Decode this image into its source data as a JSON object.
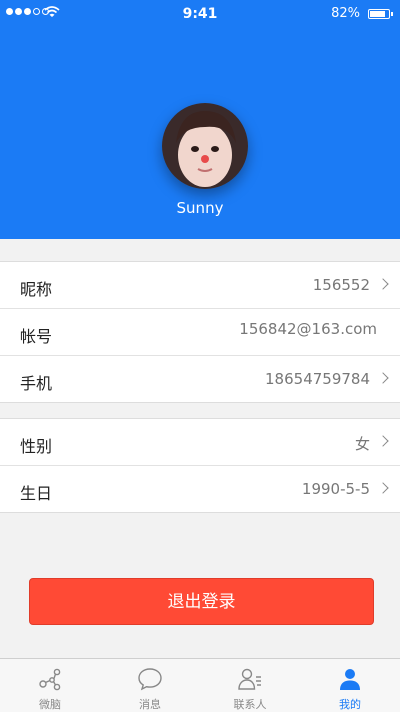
{
  "status_bar": {
    "time": "9:41",
    "battery": "82%",
    "battery_level": 0.82
  },
  "profile": {
    "username": "Sunny"
  },
  "info_group_1": [
    {
      "label": "昵称",
      "value": "156552",
      "has_arrow": true
    },
    {
      "label": "帐号",
      "value": "156842@163.com",
      "has_arrow": false
    },
    {
      "label": "手机",
      "value": "18654759784",
      "has_arrow": true
    }
  ],
  "info_group_2": [
    {
      "label": "性别",
      "value": "女",
      "has_arrow": true
    },
    {
      "label": "生日",
      "value": "1990-5-5",
      "has_arrow": true
    }
  ],
  "logout": {
    "label": "退出登录"
  },
  "tabbar": [
    {
      "label": "微脑",
      "icon": "share-icon",
      "active": false
    },
    {
      "label": "消息",
      "icon": "message-icon",
      "active": false
    },
    {
      "label": "联系人",
      "icon": "contacts-icon",
      "active": false
    },
    {
      "label": "我的",
      "icon": "person-icon",
      "active": true
    }
  ],
  "colors": {
    "primary": "#1b7bf5",
    "logout": "#ff4a35",
    "background": "#f2f2f2"
  }
}
